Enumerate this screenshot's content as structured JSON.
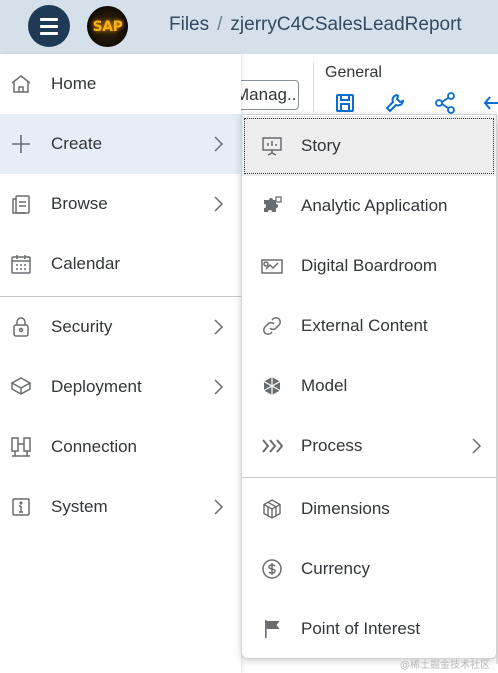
{
  "shell": {
    "logo_text": "SAP",
    "breadcrumb_root": "Files",
    "breadcrumb_separator": "/",
    "breadcrumb_current": "zjerryC4CSalesLeadReport"
  },
  "toolbar": {
    "manage_button": "Manag...",
    "general_label": "General"
  },
  "left_menu": {
    "items": [
      {
        "label": "Home",
        "icon": "home-icon"
      },
      {
        "label": "Create",
        "icon": "plus-icon"
      },
      {
        "label": "Browse",
        "icon": "browse-icon"
      },
      {
        "label": "Calendar",
        "icon": "calendar-icon"
      },
      {
        "label": "Security",
        "icon": "lock-icon"
      },
      {
        "label": "Deployment",
        "icon": "deployment-icon"
      },
      {
        "label": "Connection",
        "icon": "connection-icon"
      },
      {
        "label": "System",
        "icon": "info-icon"
      }
    ],
    "active": "Create"
  },
  "create_submenu": {
    "items": [
      {
        "label": "Story",
        "icon": "story-icon"
      },
      {
        "label": "Analytic Application",
        "icon": "puzzle-icon"
      },
      {
        "label": "Digital Boardroom",
        "icon": "boardroom-icon"
      },
      {
        "label": "External Content",
        "icon": "link-icon"
      },
      {
        "label": "Model",
        "icon": "model-icon"
      },
      {
        "label": "Process",
        "icon": "process-icon"
      },
      {
        "label": "Dimensions",
        "icon": "dimensions-icon"
      },
      {
        "label": "Currency",
        "icon": "currency-icon"
      },
      {
        "label": "Point of Interest",
        "icon": "flag-icon"
      }
    ],
    "focused": "Story"
  },
  "watermark": "@稀土掘金技术社区",
  "colors": {
    "shell_bg": "#d5e0ea",
    "menu_button": "#1f3a55",
    "active_item_bg": "#e5eef7",
    "focused_item_bg": "#ededed",
    "accent_blue": "#0a6ed1",
    "text": "#32363a",
    "icon": "#6a6d70"
  }
}
